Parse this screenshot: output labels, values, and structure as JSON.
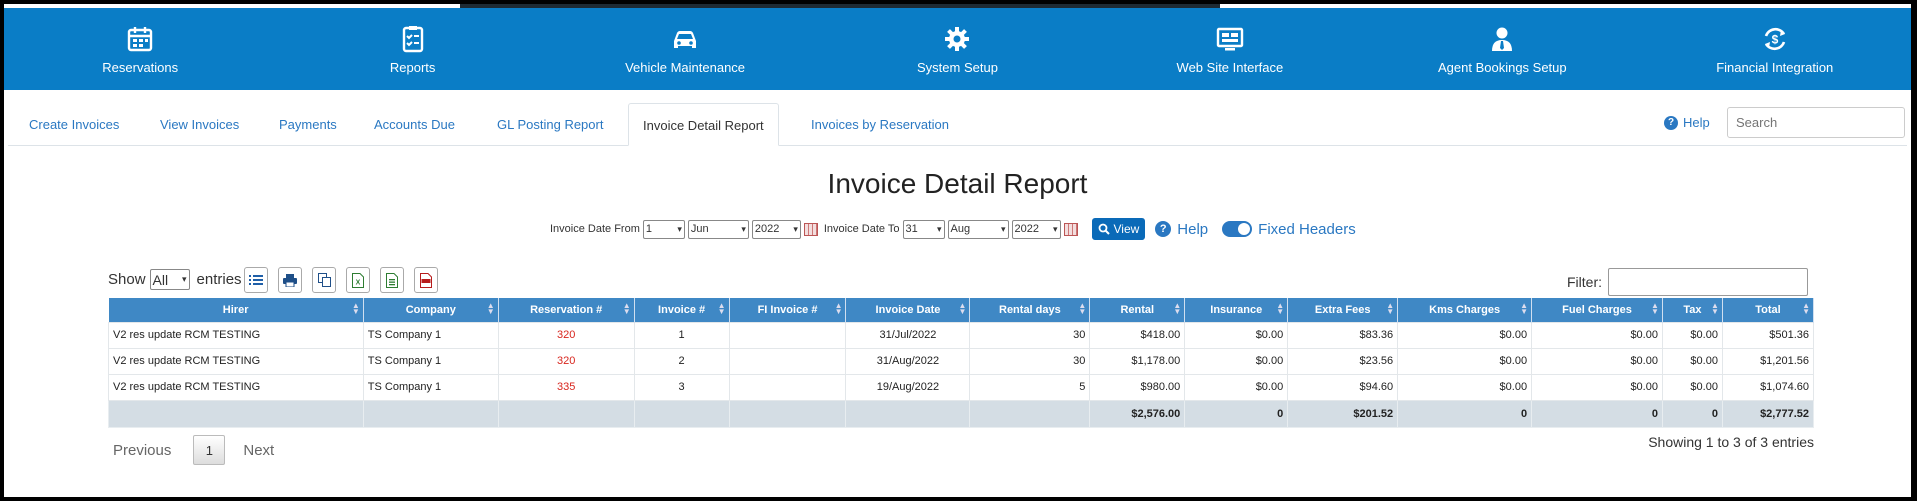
{
  "nav": [
    {
      "label": "Reservations",
      "icon": "calendar-icon"
    },
    {
      "label": "Reports",
      "icon": "checklist-icon"
    },
    {
      "label": "Vehicle Maintenance",
      "icon": "car-icon"
    },
    {
      "label": "System Setup",
      "icon": "gear-icon"
    },
    {
      "label": "Web Site Interface",
      "icon": "monitor-icon"
    },
    {
      "label": "Agent Bookings Setup",
      "icon": "agent-icon"
    },
    {
      "label": "Financial Integration",
      "icon": "dollar-sync-icon"
    }
  ],
  "tabs": [
    "Create Invoices",
    "View Invoices",
    "Payments",
    "Accounts Due",
    "GL Posting Report",
    "Invoice Detail Report",
    "Invoices by Reservation"
  ],
  "help_label": "Help",
  "search_placeholder": "Search",
  "page_title": "Invoice Detail Report",
  "filters": {
    "from_label": "Invoice Date From",
    "from_day": "1",
    "from_month": "Jun",
    "from_year": "2022",
    "to_label": "Invoice Date To",
    "to_day": "31",
    "to_month": "Aug",
    "to_year": "2022",
    "view_label": "View",
    "help_label": "Help",
    "fixed_headers_label": "Fixed Headers"
  },
  "show": {
    "prefix": "Show",
    "value": "All",
    "suffix": "entries"
  },
  "filter_label": "Filter:",
  "table": {
    "headers": [
      "Hirer",
      "Company",
      "Reservation #",
      "Invoice #",
      "FI Invoice #",
      "Invoice Date",
      "Rental days",
      "Rental",
      "Insurance",
      "Extra Fees",
      "Kms Charges",
      "Fuel Charges",
      "Tax",
      "Total"
    ],
    "rows": [
      [
        "V2 res update RCM TESTING",
        "TS Company 1",
        "320",
        "1",
        "",
        "31/Jul/2022",
        "30",
        "$418.00",
        "$0.00",
        "$83.36",
        "$0.00",
        "$0.00",
        "$0.00",
        "$501.36"
      ],
      [
        "V2 res update RCM TESTING",
        "TS Company 1",
        "320",
        "2",
        "",
        "31/Aug/2022",
        "30",
        "$1,178.00",
        "$0.00",
        "$23.56",
        "$0.00",
        "$0.00",
        "$0.00",
        "$1,201.56"
      ],
      [
        "V2 res update RCM TESTING",
        "TS Company 1",
        "335",
        "3",
        "",
        "19/Aug/2022",
        "5",
        "$980.00",
        "$0.00",
        "$94.60",
        "$0.00",
        "$0.00",
        "$0.00",
        "$1,074.60"
      ]
    ],
    "totals": [
      "",
      "",
      "",
      "",
      "",
      "",
      "",
      "$2,576.00",
      "0",
      "$201.52",
      "0",
      "0",
      "0",
      "$2,777.52"
    ]
  },
  "pager": {
    "previous": "Previous",
    "page": "1",
    "next": "Next",
    "info": "Showing 1 to 3 of 3 entries"
  }
}
